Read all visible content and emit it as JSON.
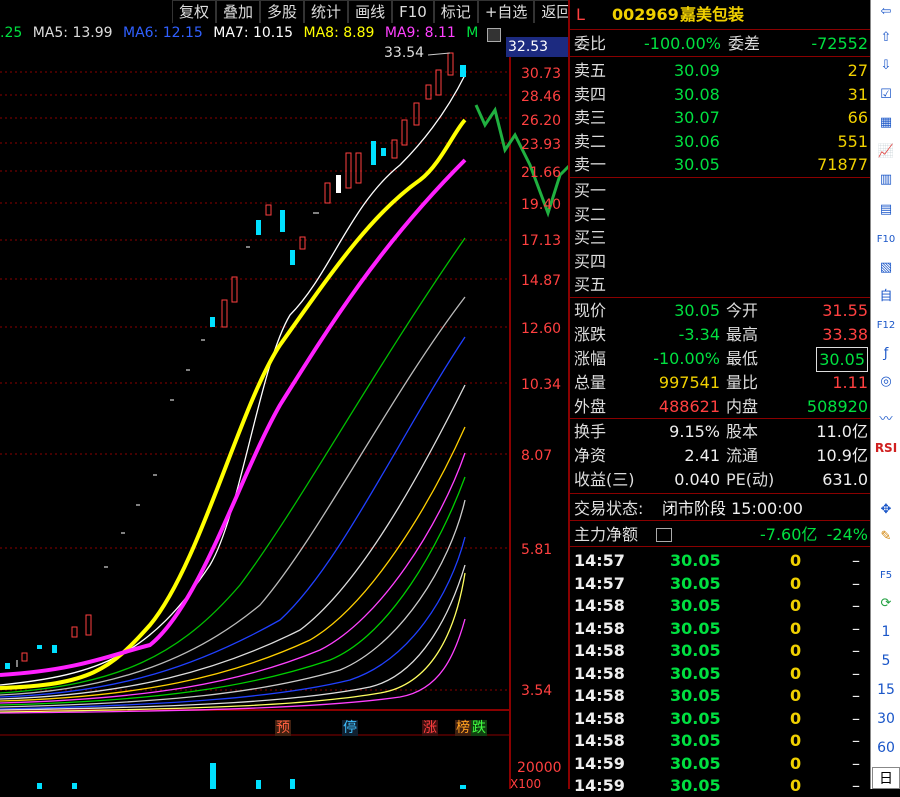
{
  "toolbar": {
    "items": [
      "复权",
      "叠加",
      "多股",
      "统计",
      "画线",
      "F10",
      "标记",
      "+自选",
      "返回"
    ]
  },
  "ma_bar": {
    "ma4": ".25",
    "ma5": "MA5: 13.99",
    "ma6": "MA6: 12.15",
    "ma7": "MA7: 10.15",
    "ma8": "MA8: 8.89",
    "ma9": "MA9: 8.11",
    "m": "M"
  },
  "chart": {
    "peak_label": "33.54",
    "current_price_tag": "32.53",
    "price_ticks": [
      "30.73",
      "28.46",
      "26.20",
      "23.93",
      "21.66",
      "19.40",
      "17.13",
      "14.87",
      "12.60",
      "10.34",
      "8.07",
      "5.81",
      "3.54"
    ],
    "volume_tick": "20000",
    "volume_tick2": "X100",
    "event_markers": [
      "预",
      "停",
      "涨",
      "榜",
      "跌"
    ]
  },
  "quote": {
    "header_l": "L",
    "code": "002969",
    "name": "嘉美包装",
    "weibi_label": "委比",
    "weibi": "-100.00%",
    "weicha_label": "委差",
    "weicha": "-72552",
    "asks": [
      {
        "label": "卖五",
        "price": "30.09",
        "vol": "27"
      },
      {
        "label": "卖四",
        "price": "30.08",
        "vol": "31"
      },
      {
        "label": "卖三",
        "price": "30.07",
        "vol": "66"
      },
      {
        "label": "卖二",
        "price": "30.06",
        "vol": "551"
      },
      {
        "label": "卖一",
        "price": "30.05",
        "vol": "71877"
      }
    ],
    "bids": [
      "买一",
      "买二",
      "买三",
      "买四",
      "买五"
    ],
    "stats": [
      {
        "l1": "现价",
        "v1": "30.05",
        "l2": "今开",
        "v2": "31.55"
      },
      {
        "l1": "涨跌",
        "v1": "-3.34",
        "l2": "最高",
        "v2": "33.38"
      },
      {
        "l1": "涨幅",
        "v1": "-10.00%",
        "l2": "最低",
        "v2": "30.05"
      },
      {
        "l1": "总量",
        "v1": "997541",
        "l2": "量比",
        "v2": "1.11"
      },
      {
        "l1": "外盘",
        "v1": "488621",
        "l2": "内盘",
        "v2": "508920"
      },
      {
        "l1": "换手",
        "v1": "9.15%",
        "l2": "股本",
        "v2": "11.0亿"
      },
      {
        "l1": "净资",
        "v1": "2.41",
        "l2": "流通",
        "v2": "10.9亿"
      },
      {
        "l1": "收益(三)",
        "v1": "0.040",
        "l2": "PE(动)",
        "v2": "631.0"
      }
    ],
    "status_label": "交易状态:",
    "status_value": "闭市阶段 15:00:00",
    "main_flow_label": "主力净额",
    "main_flow_value": "-7.60亿",
    "main_flow_pct": "-24%",
    "trades": [
      {
        "t": "14:57",
        "p": "30.05",
        "v": "0"
      },
      {
        "t": "14:57",
        "p": "30.05",
        "v": "0"
      },
      {
        "t": "14:58",
        "p": "30.05",
        "v": "0"
      },
      {
        "t": "14:58",
        "p": "30.05",
        "v": "0"
      },
      {
        "t": "14:58",
        "p": "30.05",
        "v": "0"
      },
      {
        "t": "14:58",
        "p": "30.05",
        "v": "0"
      },
      {
        "t": "14:58",
        "p": "30.05",
        "v": "0"
      },
      {
        "t": "14:58",
        "p": "30.05",
        "v": "0"
      },
      {
        "t": "14:58",
        "p": "30.05",
        "v": "0"
      },
      {
        "t": "14:59",
        "p": "30.05",
        "v": "0"
      },
      {
        "t": "14:59",
        "p": "30.05",
        "v": "0"
      }
    ],
    "trade_dash": "–"
  },
  "side_toolbar": {
    "rsi": "RSI",
    "periods": [
      "1",
      "5",
      "15",
      "30",
      "60",
      "日"
    ]
  }
}
